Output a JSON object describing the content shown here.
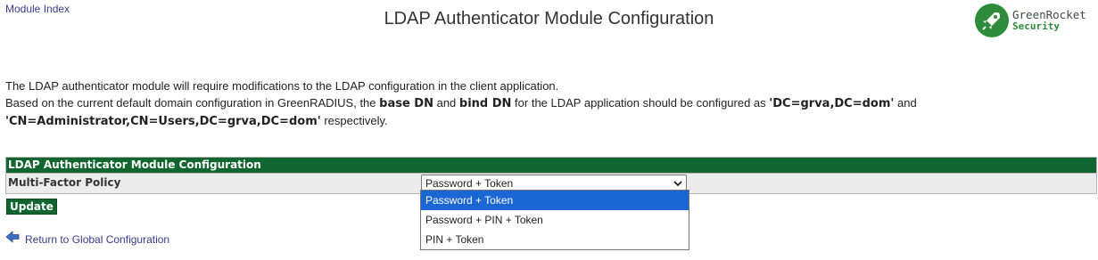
{
  "nav": {
    "module_index": "Module Index"
  },
  "page_title": "LDAP Authenticator Module Configuration",
  "logo": {
    "line1": "GreenRocket",
    "line2": "Security",
    "brand_color": "#2e8b3c"
  },
  "intro": {
    "line1": "The LDAP authenticator module will require modifications to the LDAP configuration in the client application.",
    "line2_prefix": "Based on the current default domain configuration in GreenRADIUS, the ",
    "base_dn_label": "base DN",
    "and1": " and ",
    "bind_dn_label": "bind DN",
    "line2_mid": " for the LDAP application should be configured as ",
    "base_dn_value": "'DC=grva,DC=dom'",
    "and2": " and",
    "bind_dn_value": "'CN=Administrator,CN=Users,DC=grva,DC=dom'",
    "line3_suffix": " respectively."
  },
  "config": {
    "header": "LDAP Authenticator Module Configuration",
    "policy_label": "Multi-Factor Policy",
    "policy_selected": "Password + Token",
    "policy_options": [
      "Password + Token",
      "Password + PIN + Token",
      "PIN + Token"
    ]
  },
  "update_label": "Update",
  "return_label": "Return to Global Configuration",
  "colors": {
    "header_bg": "#116630",
    "selected_option": "#1a66d2",
    "link": "#3a3a8c"
  }
}
